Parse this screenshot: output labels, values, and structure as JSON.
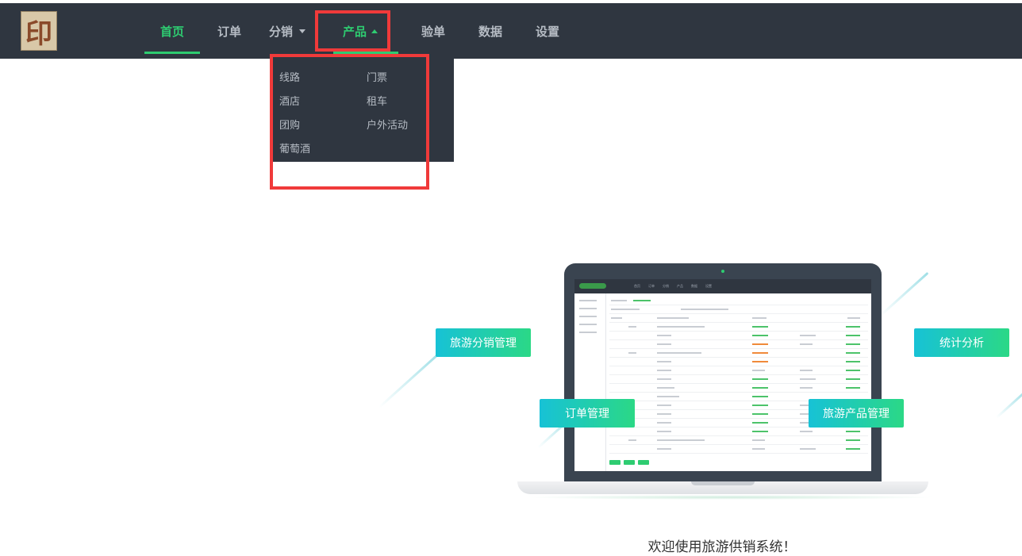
{
  "logo": {
    "glyph": "印"
  },
  "nav": {
    "items": [
      {
        "label": "首页",
        "active": true
      },
      {
        "label": "订单"
      },
      {
        "label": "分销",
        "has_dropdown": true
      },
      {
        "label": "产品",
        "has_dropdown": true,
        "open": true
      },
      {
        "label": "验单"
      },
      {
        "label": "数据"
      },
      {
        "label": "设置"
      }
    ]
  },
  "dropdown": {
    "items": [
      "线路",
      "门票",
      "酒店",
      "租车",
      "团购",
      "户外活动",
      "葡萄酒"
    ]
  },
  "hero": {
    "pills": {
      "distribution": "旅游分销管理",
      "order": "订单管理",
      "product": "旅游产品管理",
      "stats": "统计分析"
    },
    "welcome": "欢迎使用旅游供销系统！"
  },
  "colors": {
    "topbar": "#2f3640",
    "accent": "#2ecc71",
    "highlight": "#f03a3a",
    "pill_start": "#17c2d6",
    "pill_end": "#2bd886"
  }
}
